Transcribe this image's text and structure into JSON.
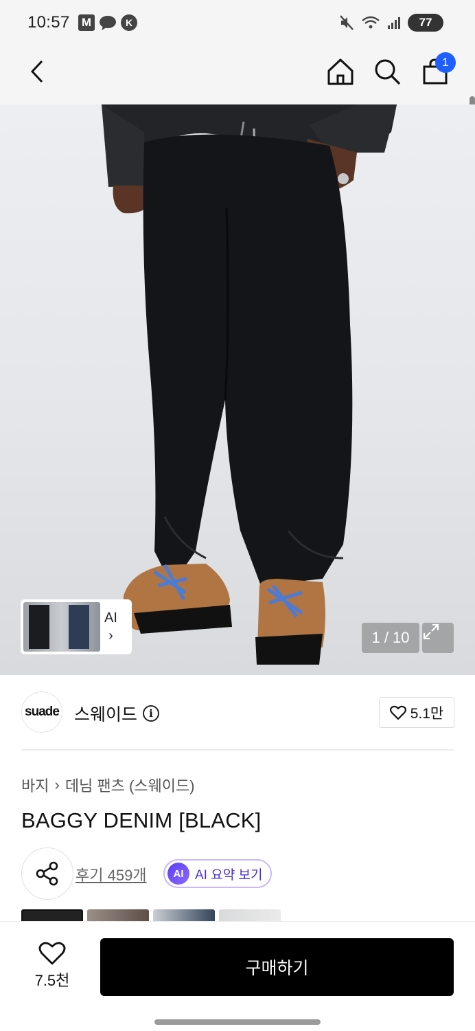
{
  "status_bar": {
    "time": "10:57",
    "app_icons": [
      "M",
      "chat",
      "K"
    ],
    "battery": "77"
  },
  "header": {
    "back_icon": "chevron-left-icon",
    "home_icon": "home-icon",
    "search_icon": "search-icon",
    "cart_icon": "shopping-bag-icon",
    "cart_badge": "1"
  },
  "gallery": {
    "ai_label": "AI",
    "ai_chevron": "›",
    "counter": "1 / 10",
    "expand_icon": "expand-icon"
  },
  "brand": {
    "logo_text": "suade",
    "name": "스웨이드",
    "info_glyph": "i",
    "likes": "5.1만"
  },
  "product": {
    "breadcrumb": [
      "바지",
      "데님 팬츠 (스웨이드)"
    ],
    "breadcrumb_separator": "›",
    "title": "BAGGY DENIM [BLACK]",
    "reviews": "후기 459개",
    "ai_badge": "AI",
    "ai_summary": "AI 요약 보기"
  },
  "bottom_bar": {
    "favorite_count": "7.5천",
    "buy_label": "구매하기"
  },
  "colors": {
    "accent_blue": "#1f5eff",
    "ai_purple": "#4d2fd6",
    "buy_black": "#000000"
  }
}
